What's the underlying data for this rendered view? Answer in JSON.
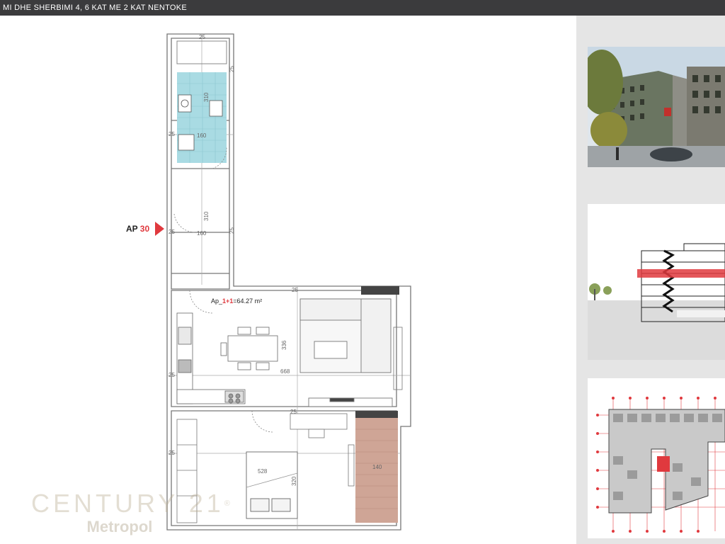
{
  "header": {
    "title": "MI DHE SHERBIMI  4, 6 KAT ME 2 KAT NENTOKE"
  },
  "plan": {
    "unit_prefix": "AP",
    "unit_number": "30",
    "apartment_prefix": "Ap_",
    "apartment_type": "1+1",
    "apartment_area": "=64.27 m²",
    "dims": {
      "d_top": "25",
      "d_bath_h": "310",
      "d_bath_w": "160",
      "d_corr_h": "310",
      "d_corr_w": "160",
      "d_living_h": "336",
      "d_living_w": "668",
      "d_bed_w": "528",
      "d_bed_h": "320",
      "d_balcony": "140",
      "d_w1": "25",
      "d_w2": "25",
      "d_w3": "25",
      "d_w4": "25",
      "d_w5": "25",
      "d_w6": "25",
      "d_w7": "25",
      "d_w8": "25"
    }
  },
  "watermark": {
    "brand": "CENTURY 21",
    "registered": "®",
    "office": "Metropol"
  },
  "colors": {
    "accent_red": "#e0393e",
    "bathroom_tile": "#a9dbe3",
    "balcony_wood": "#cfa596",
    "header_bg": "#3b3b3d",
    "panel_bg": "#e5e5e5"
  }
}
